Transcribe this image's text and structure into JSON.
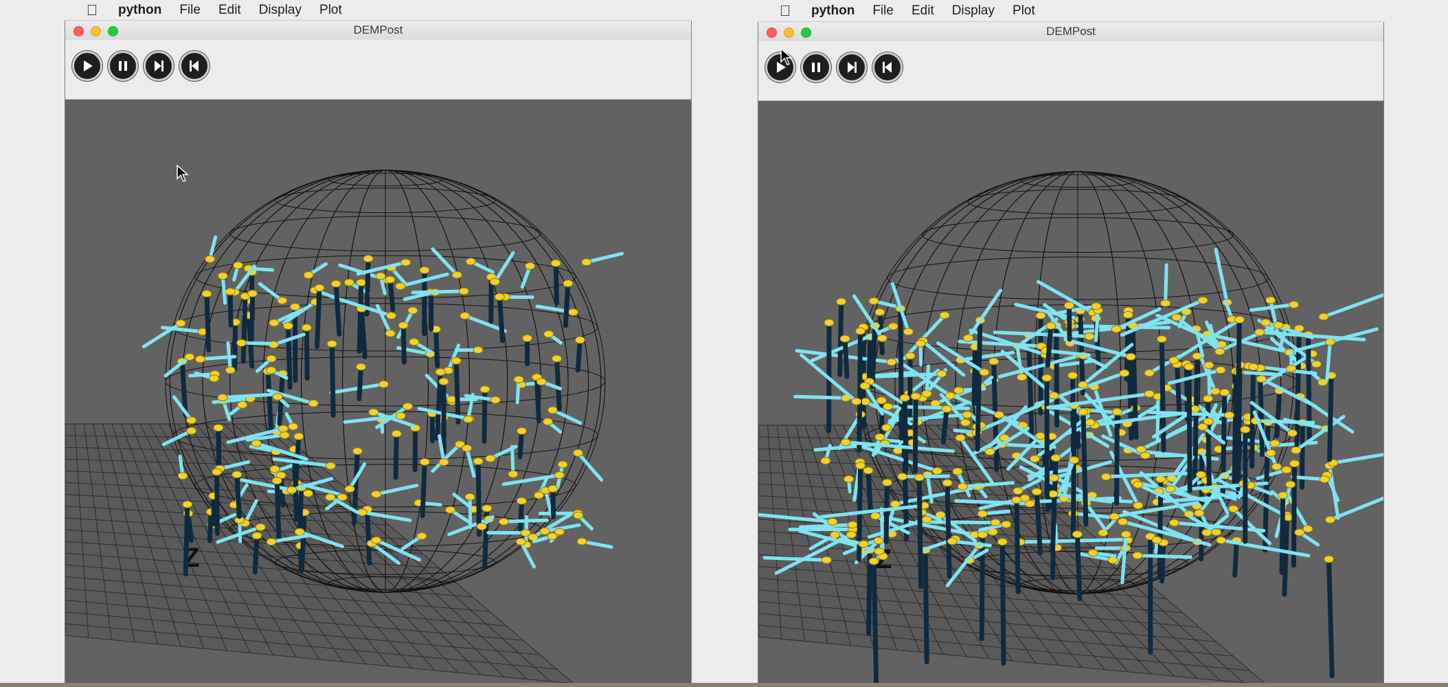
{
  "menubar_left": {
    "app_name": "python",
    "menus": [
      "File",
      "Edit",
      "Display",
      "Plot"
    ]
  },
  "menubar_right": {
    "app_name": "python",
    "menus": [
      "File",
      "Edit",
      "Display",
      "Plot"
    ]
  },
  "window_left": {
    "title": "DEMPost",
    "toolbar": [
      "play",
      "pause",
      "step-forward",
      "rewind"
    ],
    "axis_label": "Z"
  },
  "window_right": {
    "title": "DEMPost",
    "toolbar": [
      "play",
      "pause",
      "step-forward",
      "rewind"
    ],
    "axis_label": "Z"
  },
  "colors": {
    "viewport_bg": "#626262",
    "particle": "#f3d12a",
    "force_light": "#7fe3f2",
    "force_dark": "#0f2a3f",
    "wireframe": "#101010"
  }
}
